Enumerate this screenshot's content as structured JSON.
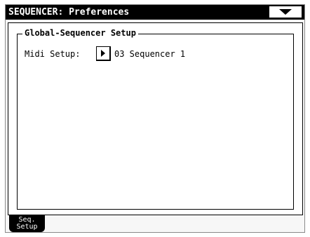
{
  "window": {
    "title": "SEQUENCER: Preferences",
    "menu_icon": "triangle-down-icon"
  },
  "group": {
    "title": "Global-Sequencer Setup",
    "midi_setup": {
      "label": "Midi Setup:",
      "value": "03 Sequencer 1",
      "button_icon": "triangle-right-icon"
    }
  },
  "tabs": [
    {
      "line1": "Seq.",
      "line2": "Setup",
      "selected": true
    }
  ],
  "colors": {
    "title_background": "#000000",
    "title_text": "#ffffff",
    "panel_background": "#ffffff",
    "frame_border": "#8a8a8a"
  }
}
